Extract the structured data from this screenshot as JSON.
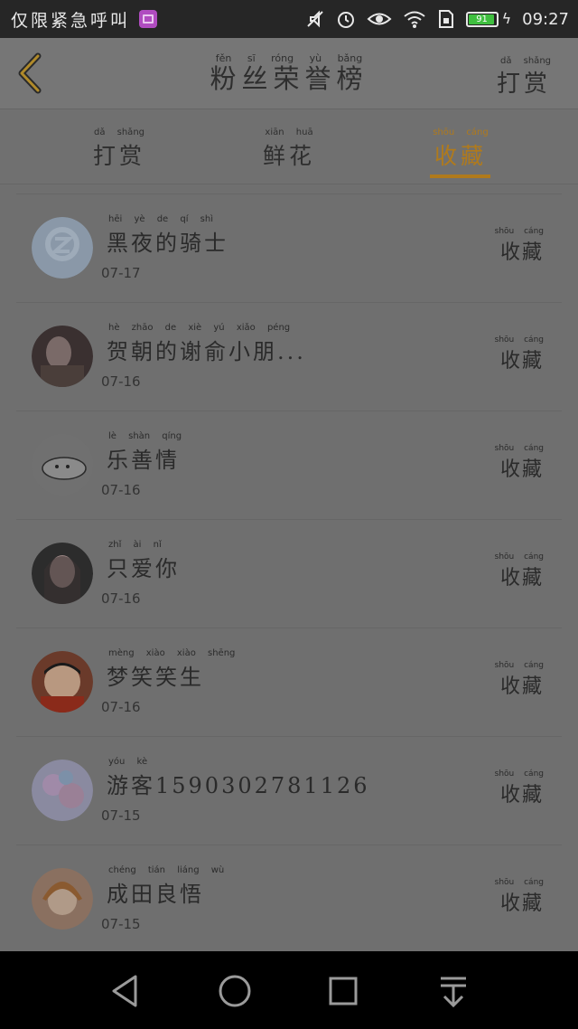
{
  "status_bar": {
    "carrier": "仅限紧急呼叫",
    "clock": "09:27",
    "battery_level": "91",
    "icons": [
      "gallery-icon",
      "mute-icon",
      "alarm-icon",
      "eye-icon",
      "wifi-icon",
      "sim-icon",
      "battery-icon"
    ]
  },
  "header": {
    "title": "粉丝荣誉榜",
    "title_pinyin": "fěn sī róng yù bǎng",
    "action": "打赏",
    "action_pinyin": "dǎ shǎng"
  },
  "tabs": [
    {
      "label": "打赏",
      "pinyin": "dǎ shǎng",
      "active": false
    },
    {
      "label": "鲜花",
      "pinyin": "xiān huā",
      "active": false
    },
    {
      "label": "收藏",
      "pinyin": "shōu cáng",
      "active": true
    }
  ],
  "accent_color": "#b07a1c",
  "rows": [
    {
      "name": "黑夜的骑士",
      "pinyin": "hēi yè de qí shì",
      "date": "07-17",
      "action": "收藏",
      "action_pinyin": "shōu cáng"
    },
    {
      "name": "贺朝的谢俞小朋...",
      "pinyin": "hè zhāo de xiè yú xiǎo péng",
      "date": "07-16",
      "action": "收藏",
      "action_pinyin": "shōu cáng"
    },
    {
      "name": "乐善情",
      "pinyin": "lè shàn qíng",
      "date": "07-16",
      "action": "收藏",
      "action_pinyin": "shōu cáng"
    },
    {
      "name": "只爱你",
      "pinyin": "zhǐ ài nǐ",
      "date": "07-16",
      "action": "收藏",
      "action_pinyin": "shōu cáng"
    },
    {
      "name": "梦笑笑生",
      "pinyin": "mèng xiào xiào shēng",
      "date": "07-16",
      "action": "收藏",
      "action_pinyin": "shōu cáng"
    },
    {
      "name": "游客1590302781126",
      "pinyin": "yóu kè",
      "date": "07-15",
      "action": "收藏",
      "action_pinyin": "shōu cáng"
    },
    {
      "name": "成田良悟",
      "pinyin": "chéng tián liáng wù",
      "date": "07-15",
      "action": "收藏",
      "action_pinyin": "shōu cáng"
    }
  ]
}
